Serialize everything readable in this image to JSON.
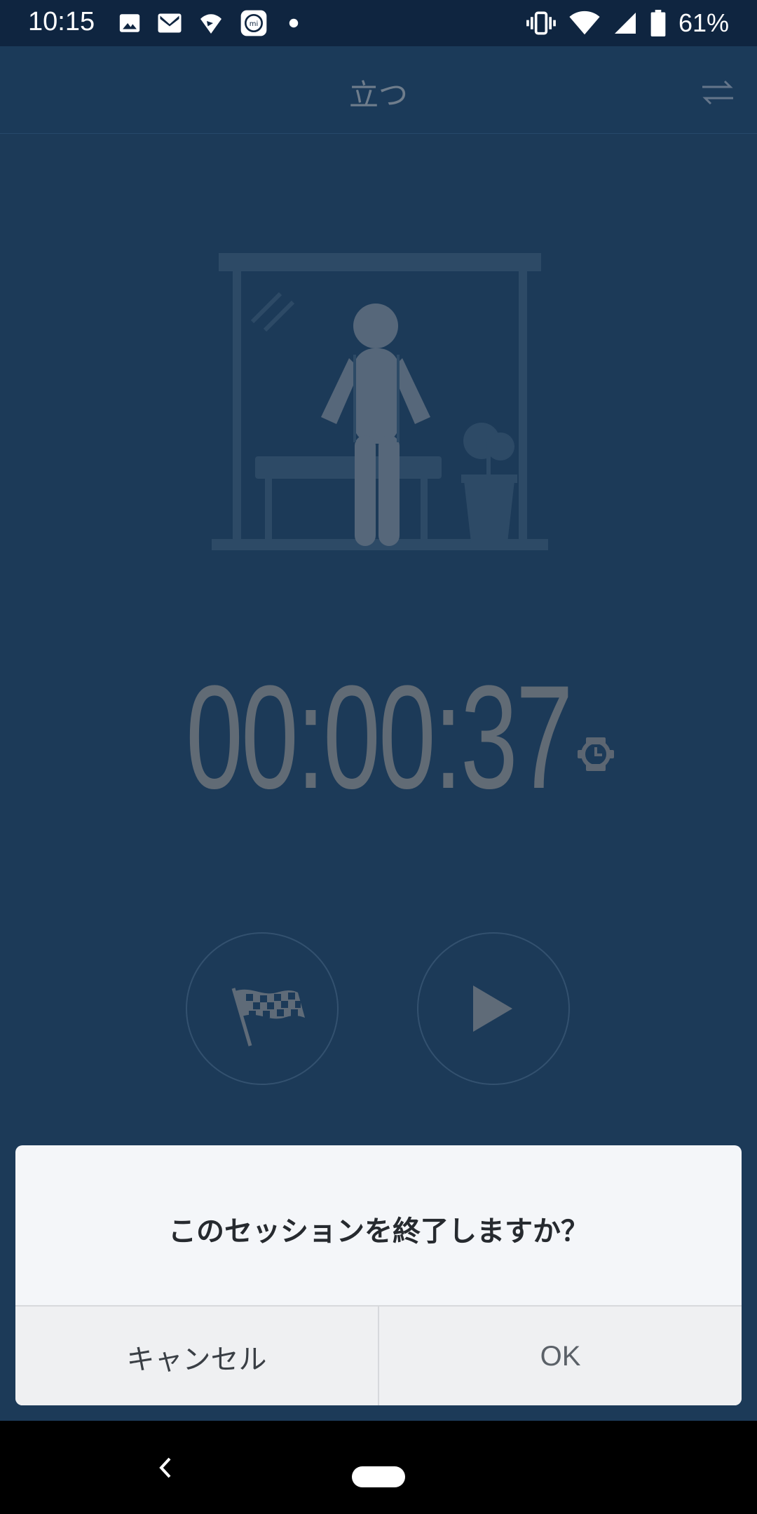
{
  "status_bar": {
    "time": "10:15",
    "battery": "61%",
    "left_icons": [
      "image-icon",
      "gmail-icon",
      "app-icon",
      "mi-icon",
      "dot-icon"
    ],
    "right_icons": [
      "vibrate-icon",
      "wifi-icon",
      "signal-icon",
      "battery-icon"
    ]
  },
  "header": {
    "title": "立つ",
    "switch_icon": "swap-arrows-icon"
  },
  "main": {
    "timer": "00:00:37",
    "timer_icon": "watch-icon",
    "buttons": {
      "finish_icon": "checkered-flag-icon",
      "play_icon": "play-icon"
    }
  },
  "dialog": {
    "message": "このセッションを終了しますか？",
    "cancel_label": "キャンセル",
    "ok_label": "OK"
  },
  "colors": {
    "background": "#1c3a58",
    "status_bar": "#0f2540",
    "dialog": "#f4f6f9",
    "muted_text": "#616b75"
  }
}
